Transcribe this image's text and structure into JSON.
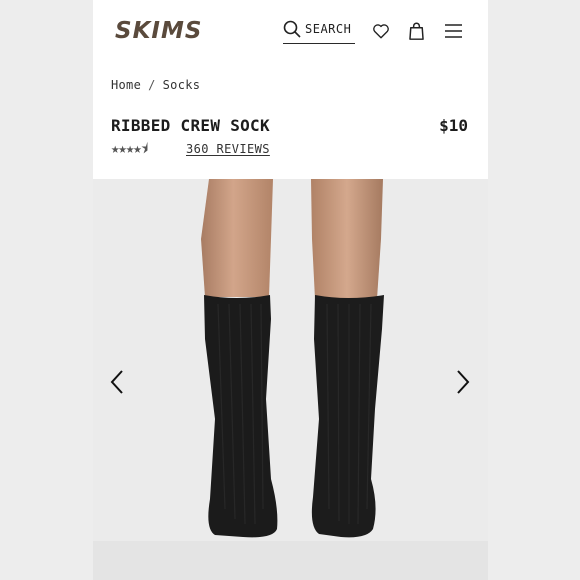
{
  "header": {
    "logo": "SKIMS",
    "search_label": "SEARCH"
  },
  "breadcrumb": {
    "home": "Home",
    "separator": "/",
    "current": "Socks"
  },
  "product": {
    "title": "RIBBED CREW SOCK",
    "price": "$10",
    "rating": 4.5,
    "stars_text": "★★★★⯨",
    "reviews_label": "360 REVIEWS"
  },
  "colors": {
    "brand": "#5a4a3c",
    "sock": "#1b1b1b",
    "skin": "#c79a7e"
  }
}
